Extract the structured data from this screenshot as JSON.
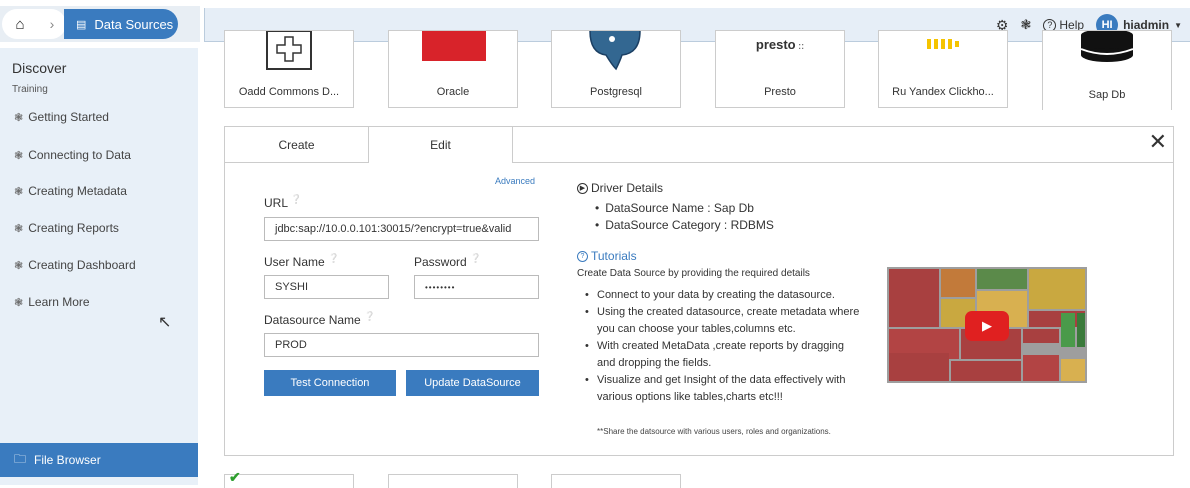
{
  "topbar": {
    "breadcrumb_current": "Data Sources",
    "help_label": "Help",
    "avatar_initials": "HI",
    "username": "hiadmin"
  },
  "sidebar": {
    "title": "Discover",
    "subtitle": "Training",
    "items": [
      {
        "label": "Getting Started"
      },
      {
        "label": "Connecting to Data"
      },
      {
        "label": "Creating Metadata"
      },
      {
        "label": "Creating Reports"
      },
      {
        "label": "Creating Dashboard"
      },
      {
        "label": "Learn More"
      }
    ],
    "file_browser": "File Browser"
  },
  "connectors": [
    {
      "label": "Oadd Commons D..."
    },
    {
      "label": "Oracle"
    },
    {
      "label": "Postgresql"
    },
    {
      "label": "Presto",
      "logo_text": "presto"
    },
    {
      "label": "Ru Yandex Clickho..."
    },
    {
      "label": "Sap Db"
    }
  ],
  "panel": {
    "tabs": {
      "create": "Create",
      "edit": "Edit"
    },
    "advanced": "Advanced",
    "url_label": "URL",
    "url_value": "jdbc:sap://10.0.0.101:30015/?encrypt=true&valid",
    "username_label": "User Name",
    "username_value": "SYSHI",
    "password_label": "Password",
    "password_value": "••••••••",
    "datasource_name_label": "Datasource Name",
    "datasource_name_value": "PROD",
    "test_button": "Test Connection",
    "update_button": "Update DataSource",
    "driver_title": "Driver Details",
    "driver_items": [
      "DataSource Name : Sap Db",
      "DataSource Category : RDBMS"
    ],
    "tutorials_title": "Tutorials",
    "tutorials_desc": "Create Data Source by providing the required details",
    "tutorial_items": [
      "Connect to your data by creating the datasource.",
      "Using the created datasource, create metadata where you can choose your tables,columns etc.",
      "With created MetaData ,create reports by dragging and dropping the fields.",
      "Visualize and get Insight of the data effectively with various options like tables,charts etc!!!"
    ],
    "share_note": "**Share the datsource with various users, roles and organizations."
  },
  "colors": {
    "accent": "#3a7bbf",
    "sidebar_bg": "#e8f0f8",
    "oracle_red": "#d8232a",
    "play_red": "#e02020"
  }
}
